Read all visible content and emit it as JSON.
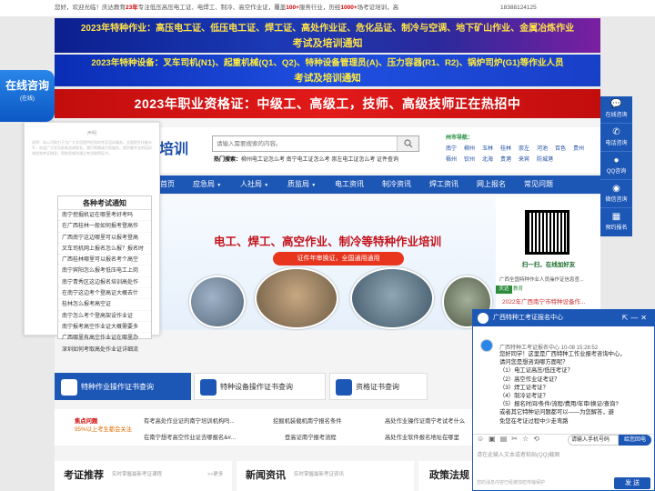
{
  "topbar": {
    "welcome_prefix": "您好，欢迎光临！庆达教育",
    "years": "23年",
    "welcome_mid": "专注低压高压电工证、电焊工、制冷、高空作业证，覆盖",
    "industries": "100+",
    "welcome_mid2": "服务行业，历经",
    "students": "1000+",
    "welcome_suffix": "场考证培训，高",
    "phone": "18388124125"
  },
  "banners": {
    "b1_line1": "2023年特种作业：高压电工证、低压电工证、焊工证、高处作业证、危化品证、制冷与空调、地下矿山作业、金属冶炼作业",
    "b1_line2": "考试及培训通知",
    "b2_line1": "2023年特种设备：叉车司机(N1)、起重机械(Q1、Q2)、特种设备管理员(A)、压力容器(R1、R2)、锅炉司炉(G1)等作业人员",
    "b2_line2": "考试及培训通知",
    "b3": "2023年职业资格证：中级工、高级工，技师、高级技师正在热招中"
  },
  "header": {
    "logo_fragment": "培训",
    "search_placeholder": "请输入需要搜索的内容。",
    "hot_label": "热门搜索：",
    "hot_links": "柳州电工证怎么考 南宁电工证怎么考 崇左电工证怎么考 证件查询",
    "city_title": "州市导航：",
    "cities_row1": [
      "南宁",
      "柳州",
      "玉林",
      "桂林",
      "崇左",
      "河池",
      "百色",
      "贵州"
    ],
    "cities_row2": [
      "梧州",
      "钦州",
      "北海",
      "贵港",
      "来宾",
      "防城港"
    ]
  },
  "nav": {
    "items": [
      "首页",
      "应急局",
      "人社局",
      "质监局",
      "电工资讯",
      "制冷资讯",
      "焊工资讯",
      "网上报名",
      "常见问题"
    ]
  },
  "hero": {
    "title": "电工、焊工、高空作业、制冷等特种作业培训",
    "subtitle": "证件年审换证，全国通用通用"
  },
  "qr": {
    "caption": "扫一扫，在线加好友",
    "desc": "广西全国特种作业人员操作证信息查...",
    "tag": "庆达",
    "tag_after": "教育",
    "news": "2022年广西南宁市特种设备作..."
  },
  "quick": {
    "q1": "特种作业操作证书查询",
    "q2": "特种设备操作证书查询",
    "q3": "资格证书查询"
  },
  "strip": {
    "red1": "焦点问题",
    "red2": "95%以上考生都会关注",
    "items": [
      "有考高处作业证的南宁培训机构吗...",
      "挖掘机装载机南宁报名条件",
      "高处作业操作证南宁考试考什么",
      "在南宁想考高空作业证去哪报名&#...",
      "登高证南宁报考流程",
      "高处作业软件报名地址在哪里"
    ]
  },
  "sections": {
    "s1_title": "考证推荐",
    "s1_sub": "实时掌握最新考证课程",
    "s1_more": ">>更多",
    "s2_title": "新闻资讯",
    "s2_sub": "实时掌握最新考证资讯",
    "s3_title": "政策法规"
  },
  "doc_panel": {
    "title": "声明",
    "text": "说明：本公司致力于为广大学员提供优质的考证培训服务，全面提升技能水平，欢迎广大学员前来咨询报名。我们将竭诚为您服务，提供最专业的培训课程和考证指导，帮助您顺利通过考试取得证书。"
  },
  "notice": {
    "title": "各种考试通知",
    "items": [
      "南宁挖掘机证在哪里考好考吗",
      "在广西桂林一般如何报考登高作",
      "广西南宁这边哪里可以报考登高",
      "叉车司机网上报名怎么报？报名时",
      "广西桂林哪里可以报名考个高空",
      "南宁宾阳怎么报考低压电工上岗",
      "南宁青秀区这边报名培训高处作",
      "在南宁这边考个登高证大概去什",
      "桂林怎么报考高空证",
      "南宁怎么考个登高架设作业证",
      "南宁报考高空作业证大概需要多",
      "广西哪里有高空作业证在哪里办",
      "深圳如何考取高处作业证详细流"
    ]
  },
  "float_consult": {
    "title": "在线咨询",
    "sub": "(在线)"
  },
  "right_bar": {
    "items": [
      "在线咨询",
      "电话咨询",
      "QQ咨询",
      "微信咨询",
      "预约报名"
    ]
  },
  "chat": {
    "title": "广西特种工考证报名中心",
    "msg_header": "广西特种工考证报名中心 10-08 15:28:52",
    "msg_lines": [
      "您好同学！这里是广西特种工作业报考咨询中心，",
      "请问您是想咨询哪方面呢？",
      "（1）电工证高压/低压考证？",
      "（2）高空作业证考证？",
      "（3）焊工证考证？",
      "（4）制冷证考证？",
      "（5）报名时间/条件/流程/费用/年审/换证/查询?",
      "或者其它特种证问题都可以——为您解答，避",
      "免您在考证过程中少走弯路"
    ],
    "phone_placeholder": "请输入手机号码",
    "call_label": "给您回电",
    "input_placeholder": "请在此输入文本或者粘贴(QQ)截图",
    "footer": "您的消息内容已经被加密传输保护",
    "send_label": "发 送"
  },
  "colors": {
    "brand_blue": "#1d57b6",
    "banner_red": "#e21a1a",
    "hero_red": "#c3121b"
  }
}
